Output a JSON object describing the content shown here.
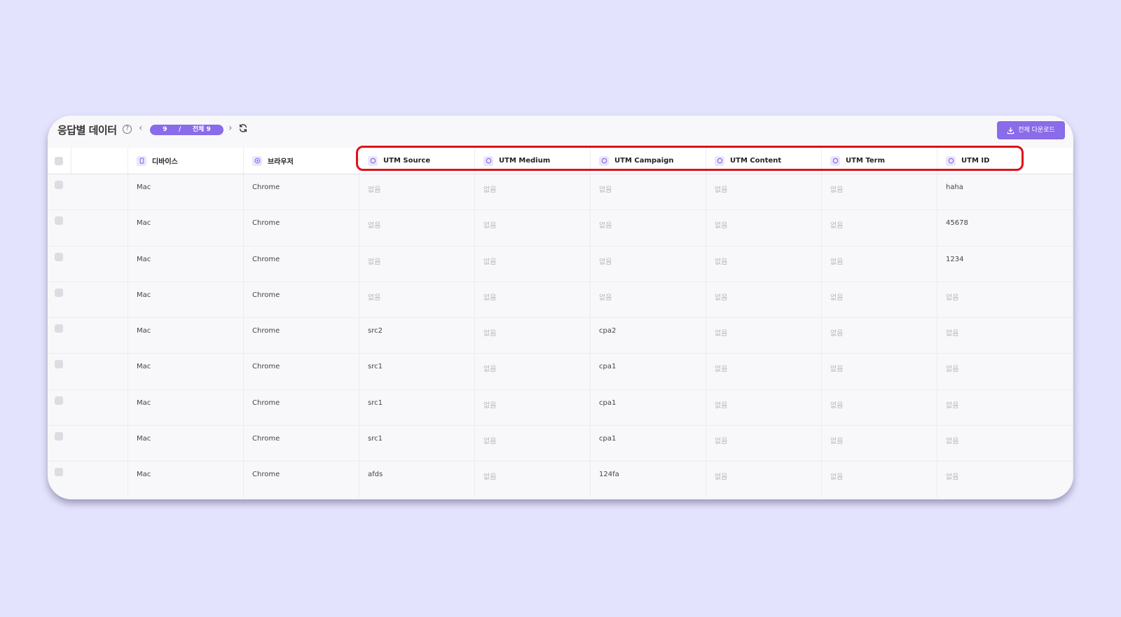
{
  "toolbar": {
    "title": "응답별 데이터",
    "pager_current": "9",
    "pager_separator": "/",
    "pager_total": "전체 9",
    "download_label": "전체 다운로드"
  },
  "columns": [
    "디바이스",
    "브라우저",
    "UTM Source",
    "UTM Medium",
    "UTM Campaign",
    "UTM Content",
    "UTM Term",
    "UTM ID"
  ],
  "rows": [
    [
      "Mac",
      "Chrome",
      "없음",
      "없음",
      "없음",
      "없음",
      "없음",
      "haha"
    ],
    [
      "Mac",
      "Chrome",
      "없음",
      "없음",
      "없음",
      "없음",
      "없음",
      "45678"
    ],
    [
      "Mac",
      "Chrome",
      "없음",
      "없음",
      "없음",
      "없음",
      "없음",
      "1234"
    ],
    [
      "Mac",
      "Chrome",
      "없음",
      "없음",
      "없음",
      "없음",
      "없음",
      "없음"
    ],
    [
      "Mac",
      "Chrome",
      "src2",
      "없음",
      "cpa2",
      "없음",
      "없음",
      "없음"
    ],
    [
      "Mac",
      "Chrome",
      "src1",
      "없음",
      "cpa1",
      "없음",
      "없음",
      "없음"
    ],
    [
      "Mac",
      "Chrome",
      "src1",
      "없음",
      "cpa1",
      "없음",
      "없음",
      "없음"
    ],
    [
      "Mac",
      "Chrome",
      "src1",
      "없음",
      "cpa1",
      "없음",
      "없음",
      "없음"
    ],
    [
      "Mac",
      "Chrome",
      "afds",
      "없음",
      "124fa",
      "없음",
      "없음",
      "없음"
    ]
  ],
  "empty_value": "없음",
  "colors": {
    "accent": "#8a6bea",
    "highlight": "#e0101a",
    "background": "#e4e3fd"
  }
}
